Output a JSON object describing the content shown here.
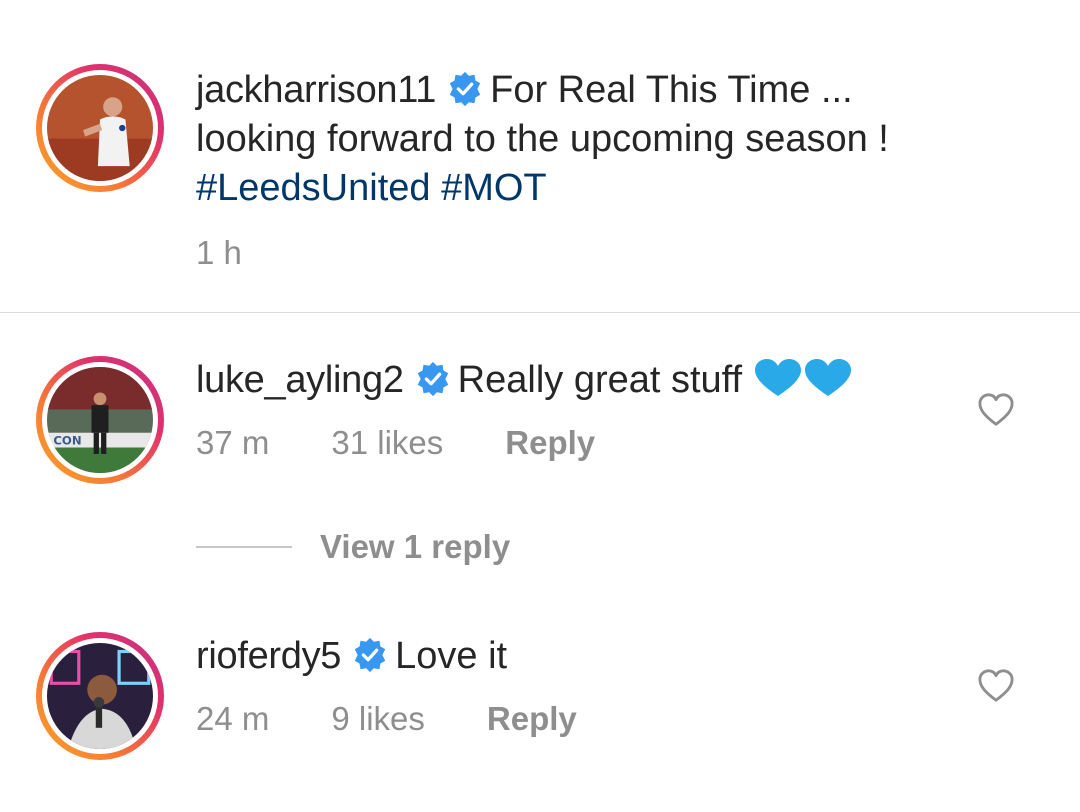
{
  "caption": {
    "username": "jackharrison11",
    "text_line1": "For Real This Time ...",
    "text_line2": "looking forward to the upcoming season !",
    "hashtags": [
      "#LeedsUnited",
      "#MOT"
    ],
    "time": "1 h"
  },
  "comments": [
    {
      "username": "luke_ayling2",
      "text": "Really great stuff",
      "emoji": "blue-heart-emoji x2",
      "time": "37 m",
      "likes": "31 likes",
      "reply_label": "Reply",
      "view_replies": "View 1 reply"
    },
    {
      "username": "rioferdy5",
      "text": "Love it",
      "time": "24 m",
      "likes": "9 likes",
      "reply_label": "Reply"
    }
  ],
  "colors": {
    "verified": "#3897f0",
    "hashtag": "#00376b",
    "meta_text": "#8e8e8e",
    "blue_heart": "#29a9e8"
  }
}
